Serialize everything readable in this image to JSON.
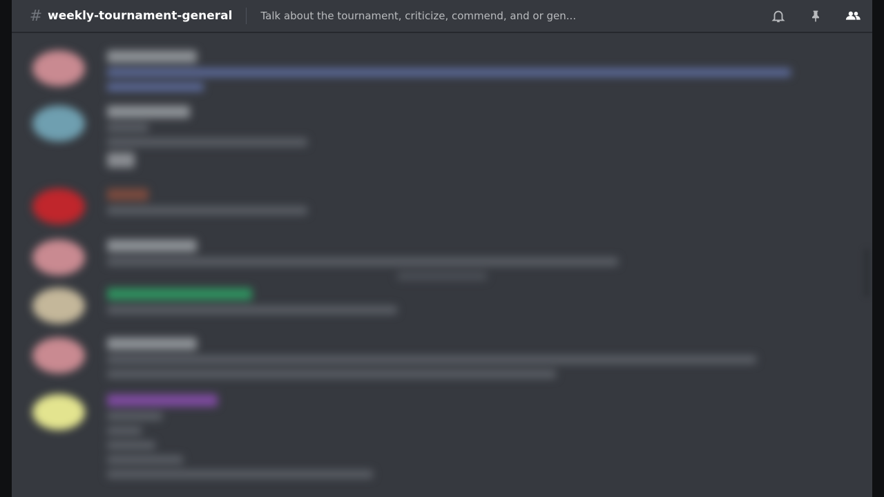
{
  "channel": {
    "hash": "#",
    "name": "weekly-tournament-general",
    "topic": "Talk about the tournament, criticize, commend, and or gen..."
  },
  "header_icons": [
    "bell-icon",
    "pin-icon",
    "member-list-icon"
  ],
  "colors": {
    "background": "#36393f",
    "header_text": "#ffffff",
    "topic_text": "#b9bbbe",
    "icon": "#b9bbbe"
  },
  "messages": [
    {
      "avatar_color": "#c98a91",
      "name_color": "#8e9297"
    },
    {
      "avatar_color": "#6f9fb0",
      "name_color": "#8e9297"
    },
    {
      "avatar_color": "#c0262c",
      "name_color": "#7a4a3e"
    },
    {
      "avatar_color": "#c98a91",
      "name_color": "#8e9297"
    },
    {
      "avatar_color": "#c4b79a",
      "name_color": "#2f8f5e"
    },
    {
      "avatar_color": "#c98a91",
      "name_color": "#8e9297"
    },
    {
      "avatar_color": "#e3e48f",
      "name_color": "#7d4a9e"
    }
  ]
}
